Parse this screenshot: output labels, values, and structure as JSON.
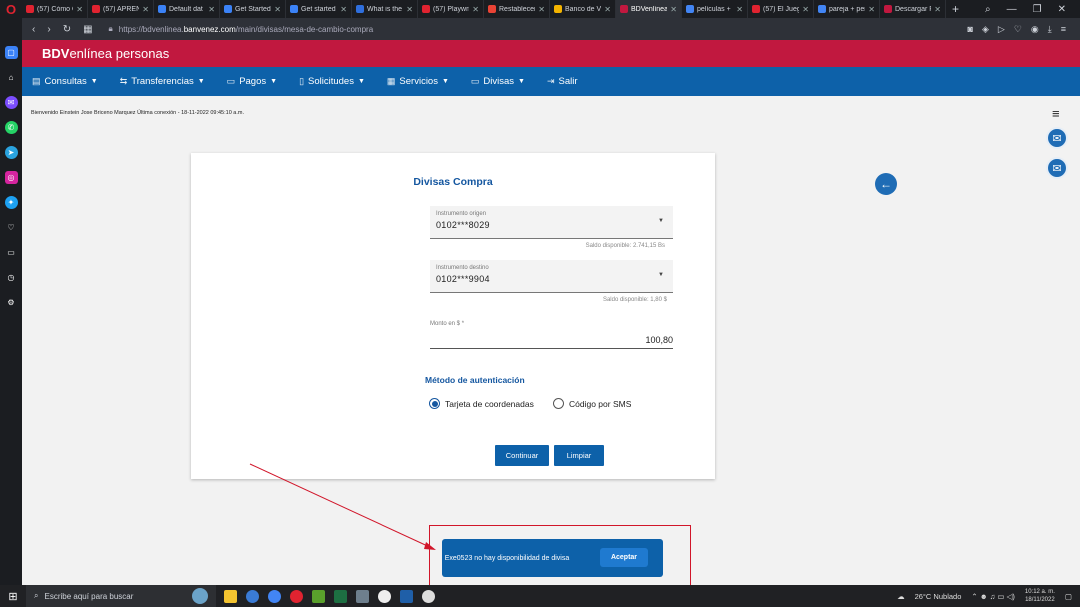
{
  "browser": {
    "tabs": [
      {
        "label": "(57) Cómo C",
        "color": "#e02330"
      },
      {
        "label": "(57) APREN",
        "color": "#e02330"
      },
      {
        "label": "Default dat",
        "color": "#3b82f6"
      },
      {
        "label": "Get Started",
        "color": "#3b82f6"
      },
      {
        "label": "Get started",
        "color": "#3b82f6"
      },
      {
        "label": "What is the",
        "color": "#2f6fde"
      },
      {
        "label": "(57) Playwri",
        "color": "#e02330"
      },
      {
        "label": "Restablecer",
        "color": "#ea4335"
      },
      {
        "label": "Banco de Ve",
        "color": "#f4b400"
      },
      {
        "label": "BDVenlínea",
        "color": "#c1183f",
        "active": true
      },
      {
        "label": "películas + l",
        "color": "#4285f4"
      },
      {
        "label": "(57) El Juego",
        "color": "#e02330"
      },
      {
        "label": "pareja + per",
        "color": "#4285f4"
      },
      {
        "label": "Descargar P",
        "color": "#c1183f"
      }
    ],
    "url_prefix": "https://bdvenlinea.",
    "url_domain": "banvenez.com",
    "url_path": "/main/divisas/mesa-de-cambio-compra"
  },
  "header": {
    "brand_bold": "BDV",
    "brand_rest": "enlínea personas"
  },
  "menu": [
    {
      "label": "Consultas",
      "icon": "▤",
      "caret": "▼"
    },
    {
      "label": "Transferencias",
      "icon": "⇆",
      "caret": "▼"
    },
    {
      "label": "Pagos",
      "icon": "▭",
      "caret": "▼"
    },
    {
      "label": "Solicitudes",
      "icon": "▯",
      "caret": "▼"
    },
    {
      "label": "Servicios",
      "icon": "▦",
      "caret": "▼"
    },
    {
      "label": "Divisas",
      "icon": "▭",
      "caret": "▼"
    },
    {
      "label": "Salir",
      "icon": "⇥",
      "caret": ""
    }
  ],
  "welcome": "Bienvenido Einstein Jose Briceno Marquez Última conexión - 18-11-2022 09:45:10 a.m.",
  "form": {
    "title": "Divisas Compra",
    "origen": {
      "label": "Instrumento origen",
      "value": "0102***8029",
      "hint": "Saldo disponible: 2.741,15 Bs"
    },
    "destino": {
      "label": "Instrumento destino",
      "value": "0102***9904",
      "hint": "Saldo disponible: 1,80 $"
    },
    "monto": {
      "label": "Monto en $ *",
      "value": "100,80"
    },
    "auth_title": "Método de autenticación",
    "radio_1": "Tarjeta de coordenadas",
    "radio_2": "Código por SMS",
    "btn_continuar": "Continuar",
    "btn_limpiar": "Limpiar"
  },
  "toast": {
    "message": "Exe0523 no hay disponibilidad de divisa",
    "button": "Aceptar"
  },
  "taskbar": {
    "search_placeholder": "Escribe aquí para buscar",
    "weather": "26°C  Nublado",
    "time": "10:12 a. m.",
    "date": "18/11/2022"
  }
}
